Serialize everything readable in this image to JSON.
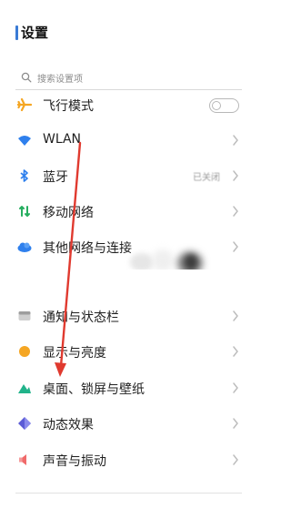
{
  "header": {
    "title": "设置"
  },
  "search": {
    "placeholder": "搜索设置项"
  },
  "group1": [
    {
      "label": "飞行模式",
      "icon": "airplane-icon",
      "control": "toggle",
      "toggle_on": false
    },
    {
      "label": "WLAN",
      "icon": "wifi-icon",
      "control": "chevron",
      "value_blurred": true
    },
    {
      "label": "蓝牙",
      "icon": "bluetooth-icon",
      "control": "chevron",
      "value": "已关闭"
    },
    {
      "label": "移动网络",
      "icon": "mobile-data-icon",
      "control": "chevron"
    },
    {
      "label": "其他网络与连接",
      "icon": "cloud-icon",
      "control": "chevron"
    }
  ],
  "group2": [
    {
      "label": "通知与状态栏",
      "icon": "notification-icon",
      "control": "chevron"
    },
    {
      "label": "显示与亮度",
      "icon": "brightness-icon",
      "control": "chevron"
    },
    {
      "label": "桌面、锁屏与壁纸",
      "icon": "wallpaper-icon",
      "control": "chevron"
    },
    {
      "label": "动态效果",
      "icon": "animation-icon",
      "control": "chevron"
    },
    {
      "label": "声音与振动",
      "icon": "sound-icon",
      "control": "chevron"
    }
  ],
  "colors": {
    "accent": "#3a7bd5",
    "annotation_arrow": "#e03a2f",
    "airplane": "#f5a623",
    "wifi": "#2f80ed",
    "bluetooth": "#2f80ed",
    "mobile_data": "#27ae60",
    "cloud": "#2f80ed",
    "brightness": "#f5a623",
    "wallpaper": "#21b38a",
    "animation": "#5b5bd6",
    "sound": "#f06a6a"
  }
}
